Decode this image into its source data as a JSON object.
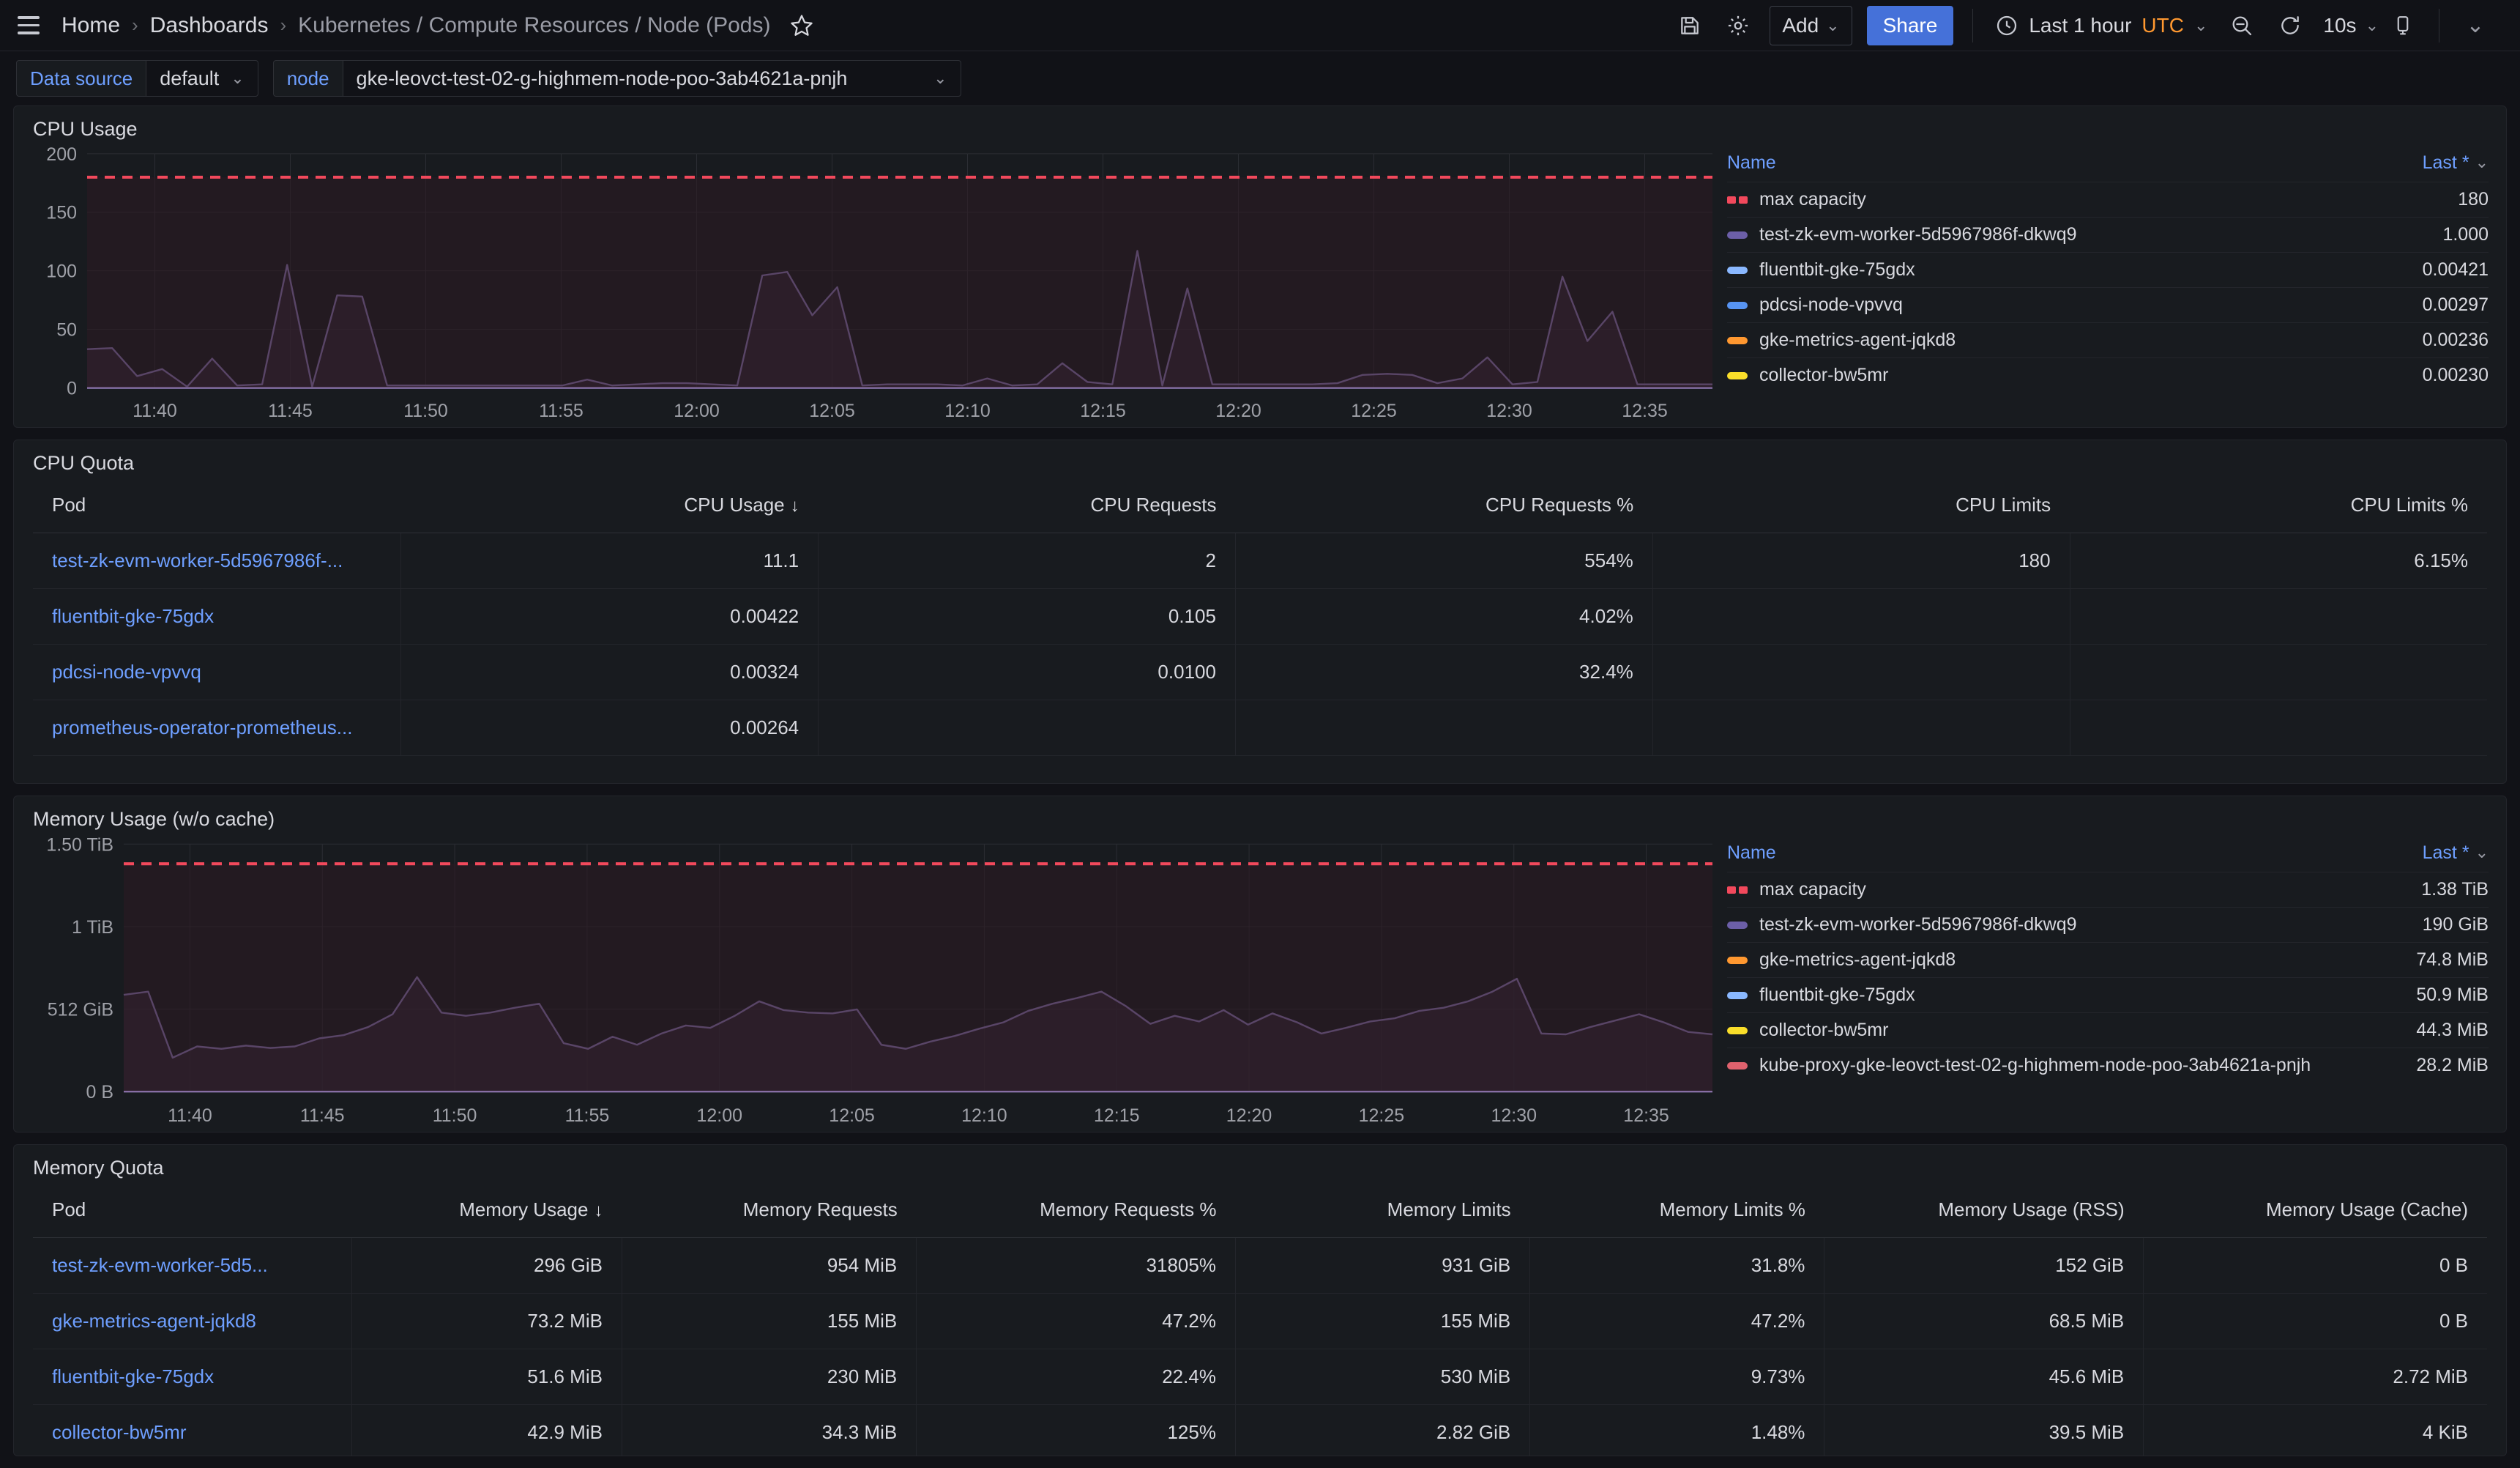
{
  "nav": {
    "menu_icon": "hamburger-icon",
    "breadcrumbs": [
      {
        "label": "Home"
      },
      {
        "label": "Dashboards"
      },
      {
        "label": "Kubernetes / Compute Resources / Node (Pods)"
      }
    ],
    "separator": "›",
    "star_icon": "star-icon",
    "save_icon": "save-icon",
    "settings_icon": "gear-icon",
    "add_label": "Add",
    "share_label": "Share",
    "time_range": "Last 1 hour",
    "timezone": "UTC",
    "clock_icon": "clock-icon",
    "zoom_out_icon": "zoom-out-icon",
    "refresh_icon": "refresh-icon",
    "refresh_interval": "10s",
    "kiosk_icon": "tv-icon",
    "chevron": "⌄"
  },
  "variables": [
    {
      "label": "Data source",
      "value": "default"
    },
    {
      "label": "node",
      "value": "gke-leovct-test-02-g-highmem-node-poo-3ab4621a-pnjh"
    }
  ],
  "panels": {
    "cpu_usage": {
      "title": "CPU Usage",
      "legend": {
        "name_header": "Name",
        "value_header": "Last *",
        "rows": [
          {
            "name": "max capacity",
            "value": "180",
            "color": "#F2495C",
            "dashed": true
          },
          {
            "name": "test-zk-evm-worker-5d5967986f-dkwq9",
            "value": "1.000",
            "color": "#6C5FA8",
            "dashed": false
          },
          {
            "name": "fluentbit-gke-75gdx",
            "value": "0.00421",
            "color": "#8AB8FF",
            "dashed": false
          },
          {
            "name": "pdcsi-node-vpvvq",
            "value": "0.00297",
            "color": "#5794F2",
            "dashed": false
          },
          {
            "name": "gke-metrics-agent-jqkd8",
            "value": "0.00236",
            "color": "#FF9830",
            "dashed": false
          },
          {
            "name": "collector-bw5mr",
            "value": "0.00230",
            "color": "#FADE2A",
            "dashed": false
          }
        ]
      }
    },
    "cpu_quota": {
      "title": "CPU Quota",
      "columns": [
        "Pod",
        "CPU Usage",
        "CPU Requests",
        "CPU Requests %",
        "CPU Limits",
        "CPU Limits %"
      ],
      "sorted_column": "CPU Usage",
      "sort_dir": "↓",
      "rows": [
        {
          "pod": "test-zk-evm-worker-5d5967986f-...",
          "cpu_usage": "11.1",
          "cpu_requests": "2",
          "cpu_requests_pct": "554%",
          "cpu_limits": "180",
          "cpu_limits_pct": "6.15%"
        },
        {
          "pod": "fluentbit-gke-75gdx",
          "cpu_usage": "0.00422",
          "cpu_requests": "0.105",
          "cpu_requests_pct": "4.02%",
          "cpu_limits": "",
          "cpu_limits_pct": ""
        },
        {
          "pod": "pdcsi-node-vpvvq",
          "cpu_usage": "0.00324",
          "cpu_requests": "0.0100",
          "cpu_requests_pct": "32.4%",
          "cpu_limits": "",
          "cpu_limits_pct": ""
        },
        {
          "pod": "prometheus-operator-prometheus...",
          "cpu_usage": "0.00264",
          "cpu_requests": "",
          "cpu_requests_pct": "",
          "cpu_limits": "",
          "cpu_limits_pct": ""
        }
      ]
    },
    "memory_usage": {
      "title": "Memory Usage (w/o cache)",
      "legend": {
        "name_header": "Name",
        "value_header": "Last *",
        "rows": [
          {
            "name": "max capacity",
            "value": "1.38 TiB",
            "color": "#F2495C",
            "dashed": true
          },
          {
            "name": "test-zk-evm-worker-5d5967986f-dkwq9",
            "value": "190 GiB",
            "color": "#6C5FA8",
            "dashed": false
          },
          {
            "name": "gke-metrics-agent-jqkd8",
            "value": "74.8 MiB",
            "color": "#FF9830",
            "dashed": false
          },
          {
            "name": "fluentbit-gke-75gdx",
            "value": "50.9 MiB",
            "color": "#8AB8FF",
            "dashed": false
          },
          {
            "name": "collector-bw5mr",
            "value": "44.3 MiB",
            "color": "#FADE2A",
            "dashed": false
          },
          {
            "name": "kube-proxy-gke-leovct-test-02-g-highmem-node-poo-3ab4621a-pnjh",
            "value": "28.2 MiB",
            "color": "#E0626E",
            "dashed": false
          }
        ]
      }
    },
    "memory_quota": {
      "title": "Memory Quota",
      "columns": [
        "Pod",
        "Memory Usage",
        "Memory Requests",
        "Memory Requests %",
        "Memory Limits",
        "Memory Limits %",
        "Memory Usage (RSS)",
        "Memory Usage (Cache)"
      ],
      "sorted_column": "Memory Usage",
      "sort_dir": "↓",
      "rows": [
        {
          "pod": "test-zk-evm-worker-5d5...",
          "usage": "296 GiB",
          "requests": "954 MiB",
          "requests_pct": "31805%",
          "limits": "931 GiB",
          "limits_pct": "31.8%",
          "rss": "152 GiB",
          "cache": "0 B"
        },
        {
          "pod": "gke-metrics-agent-jqkd8",
          "usage": "73.2 MiB",
          "requests": "155 MiB",
          "requests_pct": "47.2%",
          "limits": "155 MiB",
          "limits_pct": "47.2%",
          "rss": "68.5 MiB",
          "cache": "0 B"
        },
        {
          "pod": "fluentbit-gke-75gdx",
          "usage": "51.6 MiB",
          "requests": "230 MiB",
          "requests_pct": "22.4%",
          "limits": "530 MiB",
          "limits_pct": "9.73%",
          "rss": "45.6 MiB",
          "cache": "2.72 MiB"
        },
        {
          "pod": "collector-bw5mr",
          "usage": "42.9 MiB",
          "requests": "34.3 MiB",
          "requests_pct": "125%",
          "limits": "2.82 GiB",
          "limits_pct": "1.48%",
          "rss": "39.5 MiB",
          "cache": "4 KiB"
        }
      ]
    }
  },
  "chart_data": [
    {
      "type": "area",
      "id": "cpu_usage",
      "title": "CPU Usage",
      "xlabel": "",
      "ylabel": "",
      "ylim": [
        0,
        200
      ],
      "yticks": [
        "0",
        "50",
        "100",
        "150",
        "200"
      ],
      "ytickvals": [
        0,
        50,
        100,
        150,
        200
      ],
      "xticks": [
        "11:40",
        "11:45",
        "11:50",
        "11:55",
        "12:00",
        "12:05",
        "12:10",
        "12:15",
        "12:20",
        "12:25",
        "12:30",
        "12:35"
      ],
      "grid": true,
      "legend_position": "right",
      "threshold": {
        "name": "max capacity",
        "value": 180,
        "color": "#F2495C",
        "style": "dashed"
      },
      "series": [
        {
          "name": "test-zk-evm-worker-5d5967986f-dkwq9",
          "color": "#8F7BBB",
          "fill": "#3a2d42",
          "values": [
            33,
            34,
            10,
            16,
            1,
            25,
            2,
            3,
            105,
            1,
            79,
            78,
            2,
            2,
            2,
            2,
            2,
            2,
            2,
            2,
            7,
            2,
            3,
            4,
            4,
            3,
            2,
            96,
            99,
            62,
            86,
            2,
            3,
            3,
            3,
            2,
            8,
            2,
            3,
            21,
            5,
            3,
            117,
            2,
            85,
            3,
            3,
            3,
            3,
            3,
            4,
            11,
            12,
            11,
            4,
            8,
            26,
            3,
            5,
            95,
            40,
            65,
            3,
            3,
            3,
            3
          ]
        }
      ]
    },
    {
      "type": "area",
      "id": "memory_usage",
      "title": "Memory Usage (w/o cache)",
      "xlabel": "",
      "ylabel": "",
      "ylim_bytes": [
        0,
        1649267441664
      ],
      "yticks": [
        "0 B",
        "512 GiB",
        "1 TiB",
        "1.50 TiB"
      ],
      "ytickvals": [
        0,
        549755813888,
        1099511627776,
        1649267441664
      ],
      "xticks": [
        "11:40",
        "11:45",
        "11:50",
        "11:55",
        "12:00",
        "12:05",
        "12:10",
        "12:15",
        "12:20",
        "12:25",
        "12:30",
        "12:35"
      ],
      "grid": true,
      "legend_position": "right",
      "threshold": {
        "name": "max capacity",
        "value_label": "1.38 TiB",
        "color": "#F2495C",
        "style": "dashed"
      },
      "series": [
        {
          "name": "test-zk-evm-worker-5d5967986f-dkwq9",
          "color": "#8F7BBB",
          "fill": "#3a2d42",
          "unit": "GiB",
          "values": [
            600,
            620,
            210,
            280,
            265,
            285,
            270,
            280,
            330,
            350,
            400,
            480,
            710,
            490,
            470,
            490,
            520,
            545,
            300,
            265,
            340,
            290,
            360,
            410,
            395,
            470,
            560,
            505,
            490,
            485,
            510,
            290,
            265,
            310,
            345,
            390,
            430,
            500,
            545,
            580,
            620,
            530,
            420,
            470,
            435,
            505,
            415,
            485,
            430,
            360,
            395,
            435,
            455,
            500,
            520,
            560,
            620,
            700,
            360,
            355,
            400,
            440,
            480,
            430,
            370,
            355
          ]
        }
      ]
    }
  ]
}
